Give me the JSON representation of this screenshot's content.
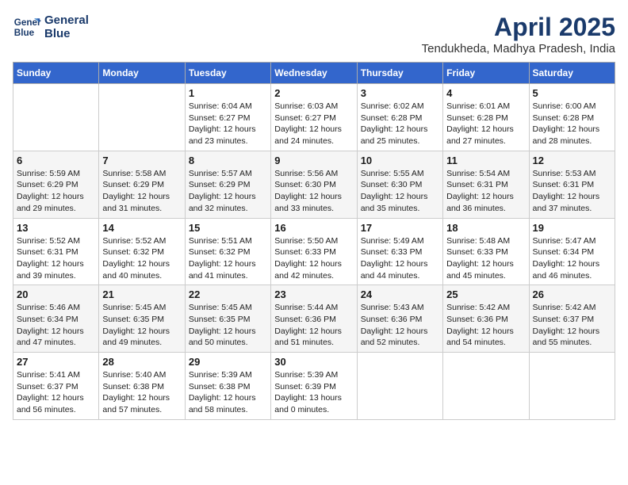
{
  "header": {
    "logo_line1": "General",
    "logo_line2": "Blue",
    "month": "April 2025",
    "location": "Tendukheda, Madhya Pradesh, India"
  },
  "days_of_week": [
    "Sunday",
    "Monday",
    "Tuesday",
    "Wednesday",
    "Thursday",
    "Friday",
    "Saturday"
  ],
  "weeks": [
    [
      {
        "day": "",
        "sunrise": "",
        "sunset": "",
        "daylight": ""
      },
      {
        "day": "",
        "sunrise": "",
        "sunset": "",
        "daylight": ""
      },
      {
        "day": "1",
        "sunrise": "Sunrise: 6:04 AM",
        "sunset": "Sunset: 6:27 PM",
        "daylight": "Daylight: 12 hours and 23 minutes."
      },
      {
        "day": "2",
        "sunrise": "Sunrise: 6:03 AM",
        "sunset": "Sunset: 6:27 PM",
        "daylight": "Daylight: 12 hours and 24 minutes."
      },
      {
        "day": "3",
        "sunrise": "Sunrise: 6:02 AM",
        "sunset": "Sunset: 6:28 PM",
        "daylight": "Daylight: 12 hours and 25 minutes."
      },
      {
        "day": "4",
        "sunrise": "Sunrise: 6:01 AM",
        "sunset": "Sunset: 6:28 PM",
        "daylight": "Daylight: 12 hours and 27 minutes."
      },
      {
        "day": "5",
        "sunrise": "Sunrise: 6:00 AM",
        "sunset": "Sunset: 6:28 PM",
        "daylight": "Daylight: 12 hours and 28 minutes."
      }
    ],
    [
      {
        "day": "6",
        "sunrise": "Sunrise: 5:59 AM",
        "sunset": "Sunset: 6:29 PM",
        "daylight": "Daylight: 12 hours and 29 minutes."
      },
      {
        "day": "7",
        "sunrise": "Sunrise: 5:58 AM",
        "sunset": "Sunset: 6:29 PM",
        "daylight": "Daylight: 12 hours and 31 minutes."
      },
      {
        "day": "8",
        "sunrise": "Sunrise: 5:57 AM",
        "sunset": "Sunset: 6:29 PM",
        "daylight": "Daylight: 12 hours and 32 minutes."
      },
      {
        "day": "9",
        "sunrise": "Sunrise: 5:56 AM",
        "sunset": "Sunset: 6:30 PM",
        "daylight": "Daylight: 12 hours and 33 minutes."
      },
      {
        "day": "10",
        "sunrise": "Sunrise: 5:55 AM",
        "sunset": "Sunset: 6:30 PM",
        "daylight": "Daylight: 12 hours and 35 minutes."
      },
      {
        "day": "11",
        "sunrise": "Sunrise: 5:54 AM",
        "sunset": "Sunset: 6:31 PM",
        "daylight": "Daylight: 12 hours and 36 minutes."
      },
      {
        "day": "12",
        "sunrise": "Sunrise: 5:53 AM",
        "sunset": "Sunset: 6:31 PM",
        "daylight": "Daylight: 12 hours and 37 minutes."
      }
    ],
    [
      {
        "day": "13",
        "sunrise": "Sunrise: 5:52 AM",
        "sunset": "Sunset: 6:31 PM",
        "daylight": "Daylight: 12 hours and 39 minutes."
      },
      {
        "day": "14",
        "sunrise": "Sunrise: 5:52 AM",
        "sunset": "Sunset: 6:32 PM",
        "daylight": "Daylight: 12 hours and 40 minutes."
      },
      {
        "day": "15",
        "sunrise": "Sunrise: 5:51 AM",
        "sunset": "Sunset: 6:32 PM",
        "daylight": "Daylight: 12 hours and 41 minutes."
      },
      {
        "day": "16",
        "sunrise": "Sunrise: 5:50 AM",
        "sunset": "Sunset: 6:33 PM",
        "daylight": "Daylight: 12 hours and 42 minutes."
      },
      {
        "day": "17",
        "sunrise": "Sunrise: 5:49 AM",
        "sunset": "Sunset: 6:33 PM",
        "daylight": "Daylight: 12 hours and 44 minutes."
      },
      {
        "day": "18",
        "sunrise": "Sunrise: 5:48 AM",
        "sunset": "Sunset: 6:33 PM",
        "daylight": "Daylight: 12 hours and 45 minutes."
      },
      {
        "day": "19",
        "sunrise": "Sunrise: 5:47 AM",
        "sunset": "Sunset: 6:34 PM",
        "daylight": "Daylight: 12 hours and 46 minutes."
      }
    ],
    [
      {
        "day": "20",
        "sunrise": "Sunrise: 5:46 AM",
        "sunset": "Sunset: 6:34 PM",
        "daylight": "Daylight: 12 hours and 47 minutes."
      },
      {
        "day": "21",
        "sunrise": "Sunrise: 5:45 AM",
        "sunset": "Sunset: 6:35 PM",
        "daylight": "Daylight: 12 hours and 49 minutes."
      },
      {
        "day": "22",
        "sunrise": "Sunrise: 5:45 AM",
        "sunset": "Sunset: 6:35 PM",
        "daylight": "Daylight: 12 hours and 50 minutes."
      },
      {
        "day": "23",
        "sunrise": "Sunrise: 5:44 AM",
        "sunset": "Sunset: 6:36 PM",
        "daylight": "Daylight: 12 hours and 51 minutes."
      },
      {
        "day": "24",
        "sunrise": "Sunrise: 5:43 AM",
        "sunset": "Sunset: 6:36 PM",
        "daylight": "Daylight: 12 hours and 52 minutes."
      },
      {
        "day": "25",
        "sunrise": "Sunrise: 5:42 AM",
        "sunset": "Sunset: 6:36 PM",
        "daylight": "Daylight: 12 hours and 54 minutes."
      },
      {
        "day": "26",
        "sunrise": "Sunrise: 5:42 AM",
        "sunset": "Sunset: 6:37 PM",
        "daylight": "Daylight: 12 hours and 55 minutes."
      }
    ],
    [
      {
        "day": "27",
        "sunrise": "Sunrise: 5:41 AM",
        "sunset": "Sunset: 6:37 PM",
        "daylight": "Daylight: 12 hours and 56 minutes."
      },
      {
        "day": "28",
        "sunrise": "Sunrise: 5:40 AM",
        "sunset": "Sunset: 6:38 PM",
        "daylight": "Daylight: 12 hours and 57 minutes."
      },
      {
        "day": "29",
        "sunrise": "Sunrise: 5:39 AM",
        "sunset": "Sunset: 6:38 PM",
        "daylight": "Daylight: 12 hours and 58 minutes."
      },
      {
        "day": "30",
        "sunrise": "Sunrise: 5:39 AM",
        "sunset": "Sunset: 6:39 PM",
        "daylight": "Daylight: 13 hours and 0 minutes."
      },
      {
        "day": "",
        "sunrise": "",
        "sunset": "",
        "daylight": ""
      },
      {
        "day": "",
        "sunrise": "",
        "sunset": "",
        "daylight": ""
      },
      {
        "day": "",
        "sunrise": "",
        "sunset": "",
        "daylight": ""
      }
    ]
  ]
}
